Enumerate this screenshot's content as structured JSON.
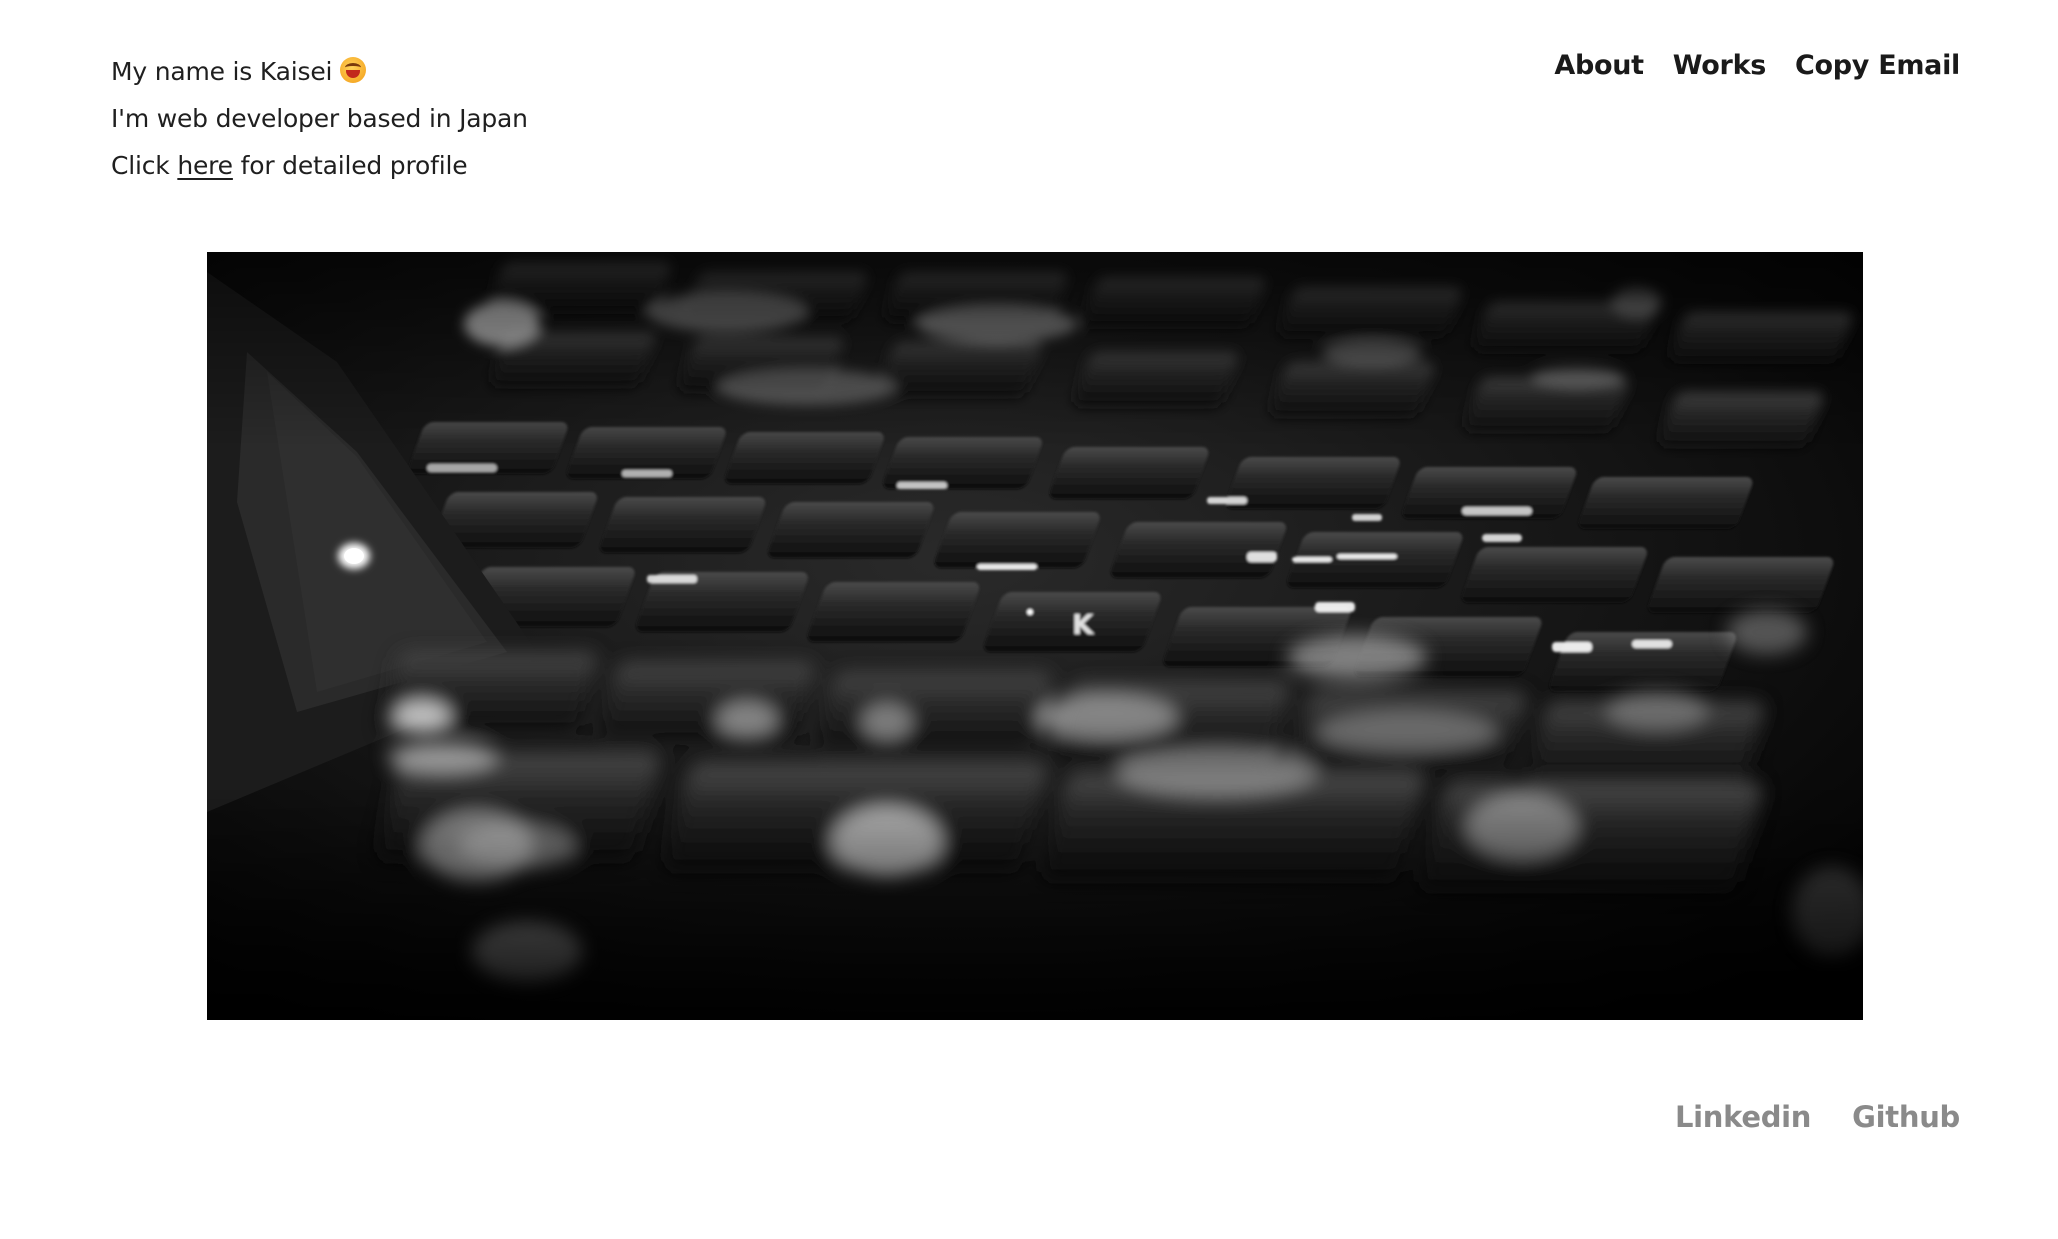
{
  "intro": {
    "line1": "My name is Kaisei",
    "emoji_icon": "grinning-face-emoji",
    "line2": "I'm web developer based in Japan",
    "line3_prefix": "Click ",
    "line3_link": "here",
    "line3_suffix": " for detailed profile"
  },
  "nav": {
    "about": "About",
    "works": "Works",
    "copy_email": "Copy Email"
  },
  "hero": {
    "image": "keyboard-photo",
    "style": "black-and-white"
  },
  "social": {
    "linkedin": "Linkedin",
    "github": "Github"
  },
  "colors": {
    "text": "#1f1f1f",
    "muted_link": "#8a8a8a",
    "background": "#ffffff"
  }
}
